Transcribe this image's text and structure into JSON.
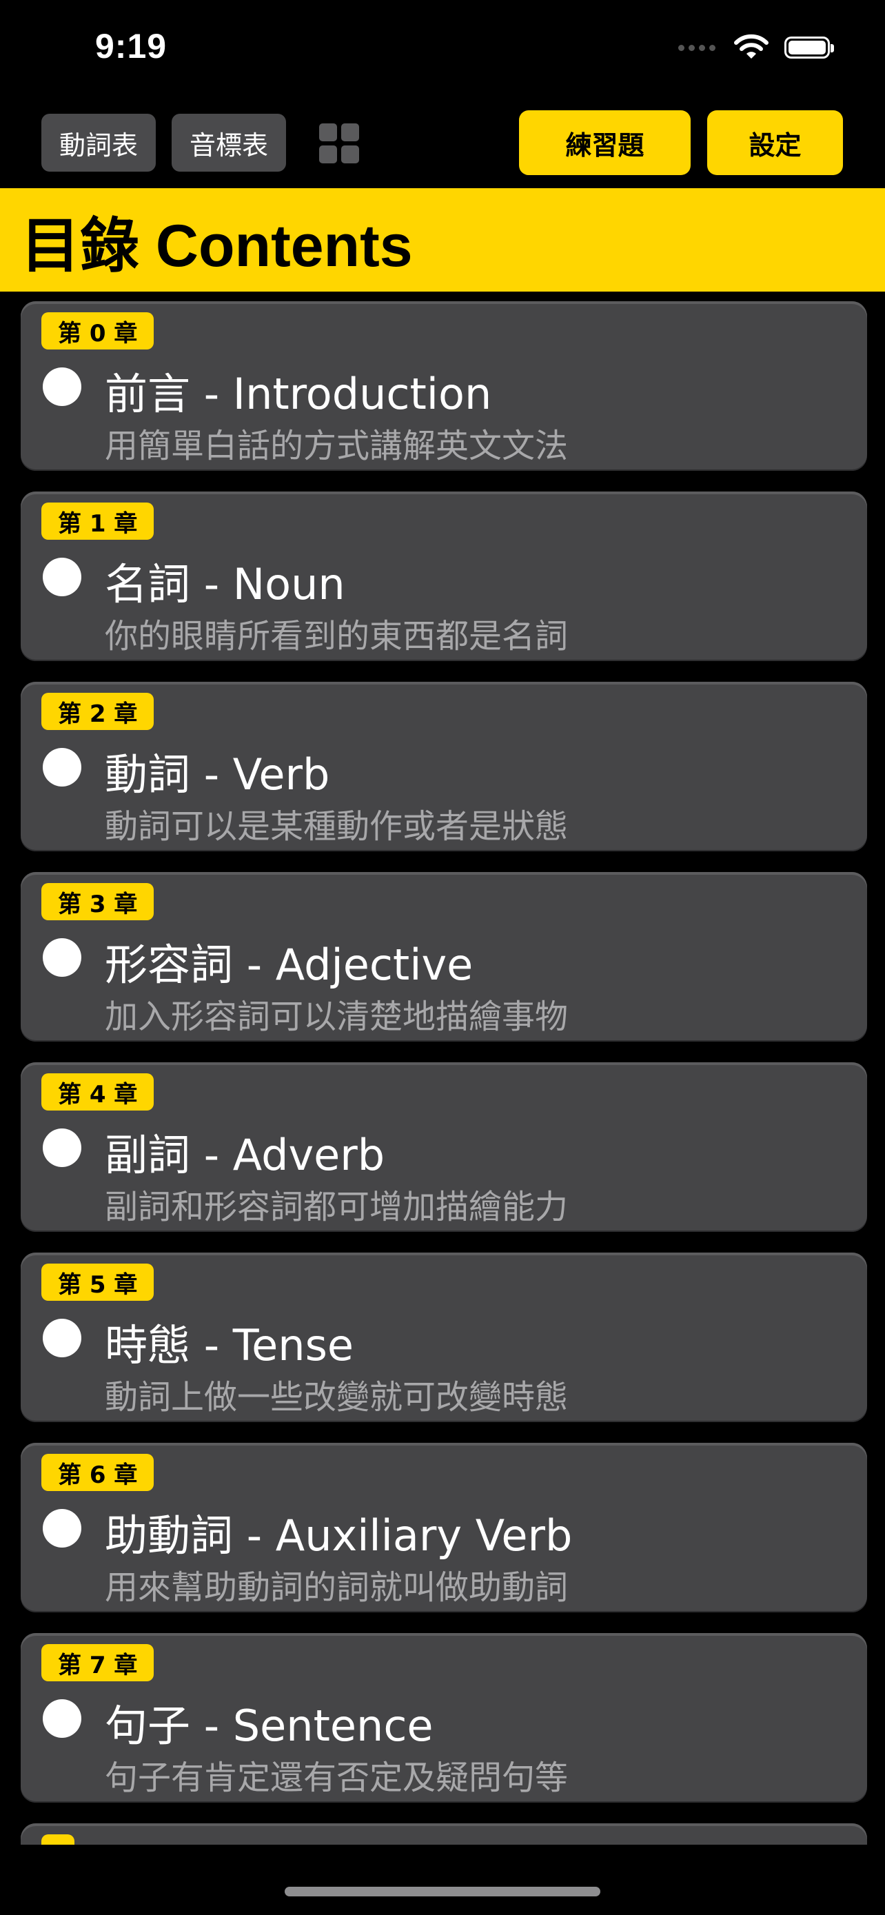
{
  "status_bar": {
    "time": "9:19"
  },
  "toolbar": {
    "verb_table_label": "動詞表",
    "phonetic_table_label": "音標表",
    "exercise_label": "練習題",
    "settings_label": "設定"
  },
  "header": {
    "title": "目錄 Contents"
  },
  "chapters": [
    {
      "chip": "第 0 章",
      "title": "前言 - Introduction",
      "subtitle": "用簡單白話的方式講解英文文法"
    },
    {
      "chip": "第 1 章",
      "title": "名詞 - Noun",
      "subtitle": "你的眼睛所看到的東西都是名詞"
    },
    {
      "chip": "第 2 章",
      "title": "動詞 - Verb",
      "subtitle": "動詞可以是某種動作或者是狀態"
    },
    {
      "chip": "第 3 章",
      "title": "形容詞 - Adjective",
      "subtitle": "加入形容詞可以清楚地描繪事物"
    },
    {
      "chip": "第 4 章",
      "title": "副詞 - Adverb",
      "subtitle": "副詞和形容詞都可增加描繪能力"
    },
    {
      "chip": "第 5 章",
      "title": "時態 - Tense",
      "subtitle": "動詞上做一些改變就可改變時態"
    },
    {
      "chip": "第 6 章",
      "title": "助動詞 - Auxiliary Verb",
      "subtitle": "用來幫助動詞的詞就叫做助動詞"
    },
    {
      "chip": "第 7 章",
      "title": "句子 - Sentence",
      "subtitle": "句子有肯定還有否定及疑問句等"
    }
  ],
  "icons": {
    "wifi": "wifi-icon",
    "battery": "battery-icon",
    "signal": "cellular-signal-icon",
    "grid": "grid-view-icon",
    "bullet": "circle-bullet-icon"
  },
  "colors": {
    "accent": "#ffd600",
    "card": "#454547",
    "background": "#000000"
  }
}
